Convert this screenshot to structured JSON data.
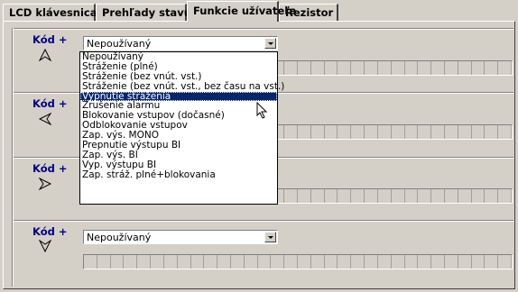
{
  "tabs": [
    {
      "label": "LCD klávesnica",
      "active": false
    },
    {
      "label": "Prehľady stavu",
      "active": false
    },
    {
      "label": "Funkcie užívateľa",
      "active": true
    },
    {
      "label": "Rezistor",
      "active": false
    }
  ],
  "groups": [
    {
      "code_label": "Kód +",
      "arrow": "arrow-up-icon",
      "combo_value": "Nepoužívaný"
    },
    {
      "code_label": "Kód +",
      "arrow": "arrow-left-icon",
      "combo_value": ""
    },
    {
      "code_label": "Kód +",
      "arrow": "arrow-right-icon",
      "combo_value": ""
    },
    {
      "code_label": "Kód +",
      "arrow": "arrow-down-icon",
      "combo_value": "Nepoužívaný"
    }
  ],
  "dropdown": {
    "selected_index": 4,
    "options": [
      "Nepoužívaný",
      "Stráženie (plné)",
      "Stráženie (bez vnút. vst.)",
      "Stráženie (bez vnút. vst., bez času na vst.)",
      "Vypnutie stráženia",
      "Zrušenie alarmu",
      "Blokovanie vstupov (dočasné)",
      "Odblokovanie vstupov",
      "Zap. výs. MONO",
      "Prepnutie výstupu BI",
      "Zap. výs. BI",
      "Vyp. výstupu BI",
      "Zap. stráž. plné+blokovania"
    ]
  },
  "colors": {
    "background": "#d4d0c8",
    "code_label": "#000080",
    "selection": "#0a246a"
  }
}
